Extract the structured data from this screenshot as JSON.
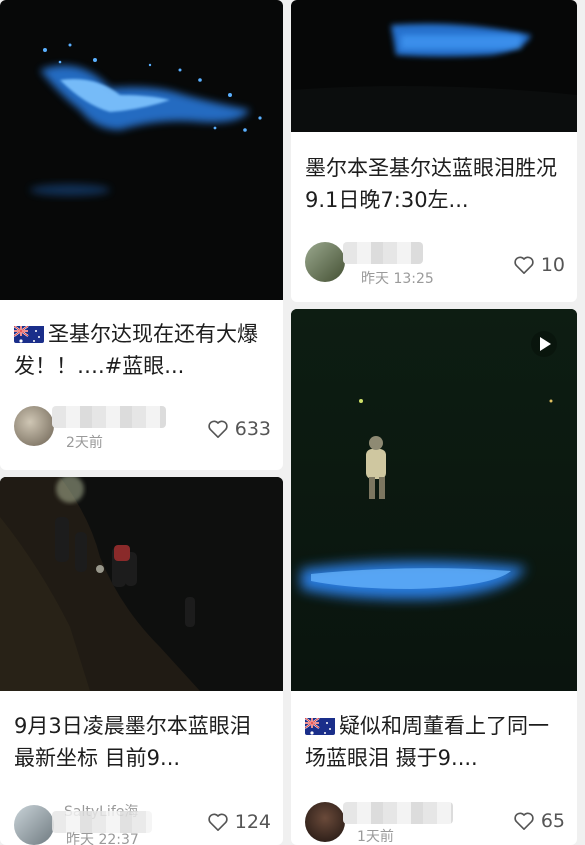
{
  "cards": [
    {
      "title": "圣基尔达现在还有大爆发！！….#蓝眼...",
      "time": "2天前",
      "likes": "633",
      "flag": true
    },
    {
      "title": "墨尔本圣基尔达蓝眼泪胜况9.1日晚7:30左...",
      "time": "昨天 13:25",
      "likes": "10",
      "flag": false
    },
    {
      "title": "9月3日凌晨墨尔本蓝眼泪最新坐标 目前9...",
      "time": "昨天 22:37",
      "likes": "124",
      "flag": false,
      "author": "SaltyLife海"
    },
    {
      "title": "疑似和周董看上了同一场蓝眼泪 摄于9....",
      "time": "1天前",
      "likes": "65",
      "flag": true
    }
  ],
  "icons": {
    "like": "heart-icon",
    "video": "play-icon",
    "flag": "australia-flag-icon"
  },
  "colors": {
    "bioluminescence": "#2f8cff",
    "night": "#050607"
  }
}
